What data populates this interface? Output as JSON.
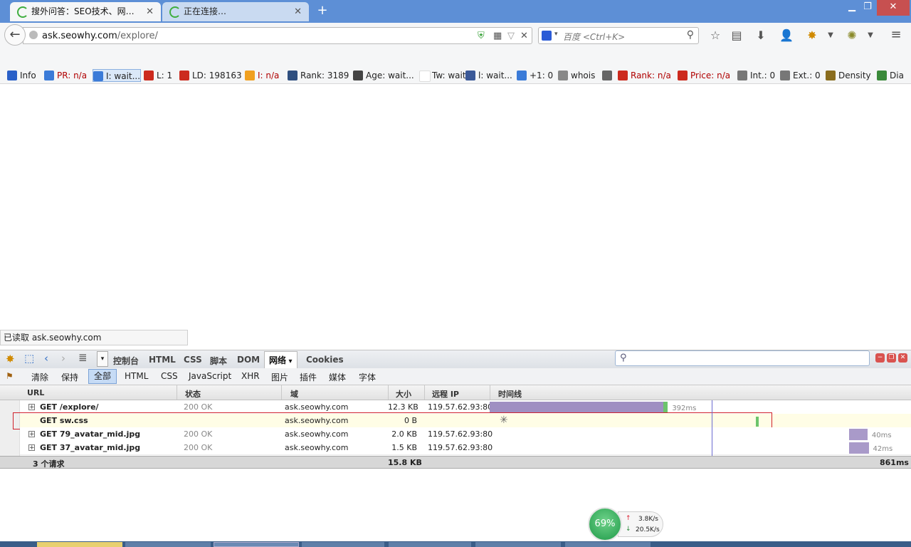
{
  "tabs": [
    {
      "title": "搜外问答：SEO技术、网…",
      "active": true
    },
    {
      "title": "正在连接…",
      "active": false
    }
  ],
  "window_buttons": {
    "min": "▁",
    "restore": "❐",
    "close": "✕"
  },
  "nav": {
    "url_domain": "ask.seowhy.com",
    "url_path": "/explore/",
    "search_placeholder": "百度 <Ctrl+K>"
  },
  "seo_bar": [
    {
      "label": "Info",
      "color": "#2a60c8",
      "red": false
    },
    {
      "label": "PR: n/a",
      "color": "#3b7bd8",
      "red": true
    },
    {
      "label": "I: wait...",
      "color": "#3b7bd8",
      "red": false,
      "selected": true
    },
    {
      "label": "L: 1",
      "color": "#cc2a1e",
      "red": false
    },
    {
      "label": "LD: 198163",
      "color": "#cc2a1e",
      "red": false
    },
    {
      "label": "I: n/a",
      "color": "#f0a020",
      "red": true
    },
    {
      "label": "Rank: 3189",
      "color": "#2f4f7f",
      "red": false
    },
    {
      "label": "Age: wait...",
      "color": "#444444",
      "red": false
    },
    {
      "label": "Tw: wait...",
      "color": "#ffffff",
      "red": false
    },
    {
      "label": "l: wait...",
      "color": "#3b5998",
      "red": false
    },
    {
      "label": "+1: 0",
      "color": "#3b7bd8",
      "red": false
    },
    {
      "label": "whois",
      "color": "#888888",
      "red": false
    },
    {
      "label": "",
      "color": "#666666",
      "red": false
    },
    {
      "label": "Rank: n/a",
      "color": "#cc2a1e",
      "red": true
    },
    {
      "label": "Price: n/a",
      "color": "#cc2a1e",
      "red": true
    },
    {
      "label": "Int.: 0",
      "color": "#777777",
      "red": false
    },
    {
      "label": "Ext.: 0",
      "color": "#777777",
      "red": false
    },
    {
      "label": "Density",
      "color": "#8a6d1e",
      "red": false
    },
    {
      "label": "Dia",
      "color": "#3a8a3a",
      "red": false
    }
  ],
  "status_text": "已读取 ask.seowhy.com",
  "firebug": {
    "tabs": [
      "控制台",
      "HTML",
      "CSS",
      "脚本",
      "DOM",
      "网络",
      "Cookies"
    ],
    "current_tab": "网络",
    "filters": [
      "清除",
      "保持",
      "全部",
      "HTML",
      "CSS",
      "JavaScript",
      "XHR",
      "图片",
      "插件",
      "媒体",
      "字体"
    ],
    "current_filter": "全部"
  },
  "net": {
    "columns": [
      "URL",
      "状态",
      "域",
      "大小",
      "远程 IP",
      "时间线"
    ],
    "rows": [
      {
        "url": "GET /explore/",
        "status": "200 OK",
        "domain": "ask.seowhy.com",
        "size": "12.3 KB",
        "ip": "119.57.62.93:80",
        "time": "392ms",
        "bar_start": 0.0,
        "bar_end": 0.447,
        "color": "#9f8fc2"
      },
      {
        "url": "GET sw.css",
        "status": "",
        "domain": "ask.seowhy.com",
        "size": "0 B",
        "ip": "",
        "time": "",
        "bar_start": 0.0,
        "bar_end": 0.0,
        "color": "#9f8fc2"
      },
      {
        "url": "GET 79_avatar_mid.jpg",
        "status": "200 OK",
        "domain": "ask.seowhy.com",
        "size": "2.0 KB",
        "ip": "119.57.62.93:80",
        "time": "40ms",
        "bar_start": 0.902,
        "bar_end": 0.948,
        "color": "#a99ac9"
      },
      {
        "url": "GET 37_avatar_mid.jpg",
        "status": "200 OK",
        "domain": "ask.seowhy.com",
        "size": "1.5 KB",
        "ip": "119.57.62.93:80",
        "time": "42ms",
        "bar_start": 0.902,
        "bar_end": 0.951,
        "color": "#a99ac9"
      }
    ],
    "summary": {
      "count": "3 个请求",
      "total_size": "15.8 KB",
      "total_time": "861ms"
    }
  },
  "monitor": {
    "percent": "69%",
    "up": "3.8K/s",
    "down": "20.5K/s"
  }
}
